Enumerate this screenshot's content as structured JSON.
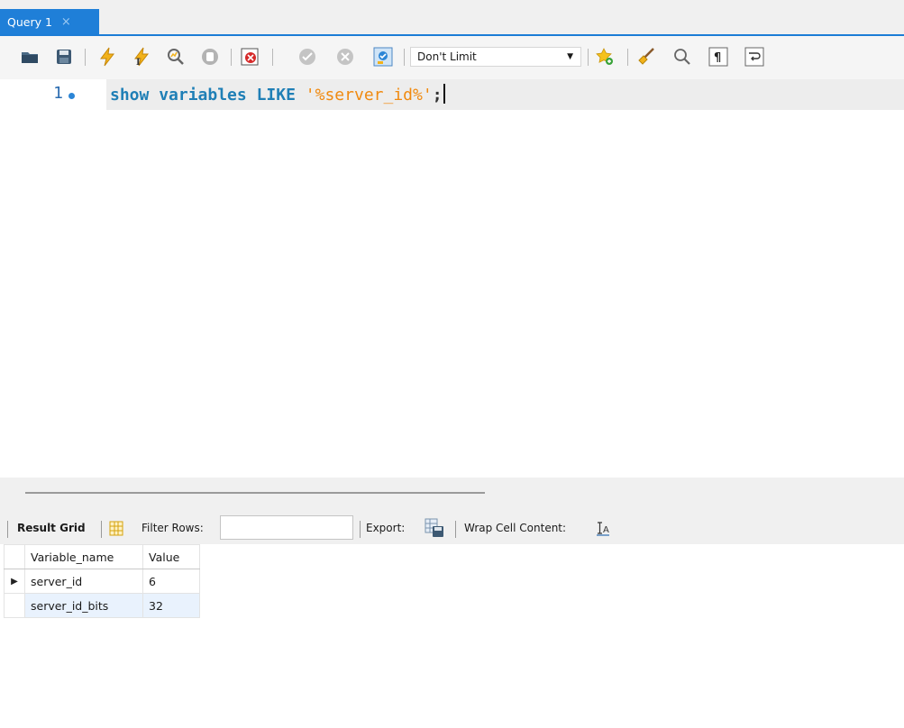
{
  "tab": {
    "title": "Query 1",
    "close_glyph": "×"
  },
  "toolbar": {
    "icons": [
      "open-folder-icon",
      "save-icon",
      "execute-icon",
      "execute-current-icon",
      "explain-icon",
      "stop-icon",
      "toggle-error-icon",
      "commit-icon",
      "rollback-icon",
      "autocommit-icon",
      "bookmark-icon",
      "beautify-icon",
      "find-icon",
      "invisible-chars-icon",
      "wrap-icon"
    ],
    "limit": {
      "value": "Don't Limit"
    }
  },
  "editor": {
    "line_number": "1",
    "sql": {
      "kw1": "show",
      "kw2": "variables",
      "kw3": "LIKE",
      "string": "'%server_id%'",
      "terminator": ";"
    }
  },
  "result_toolbar": {
    "result_grid": "Result Grid",
    "filter_rows": "Filter Rows:",
    "filter_value": "",
    "export": "Export:",
    "wrap_cell": "Wrap Cell Content:"
  },
  "grid": {
    "columns": [
      "Variable_name",
      "Value"
    ],
    "rows": [
      {
        "name": "server_id",
        "value": "6",
        "selected": true
      },
      {
        "name": "server_id_bits",
        "value": "32",
        "selected": false
      }
    ]
  },
  "colors": {
    "accent": "#1f7fd8",
    "keyword": "#1f7fb6",
    "string": "#f08a10",
    "alt_row": "#e9f2fd"
  }
}
